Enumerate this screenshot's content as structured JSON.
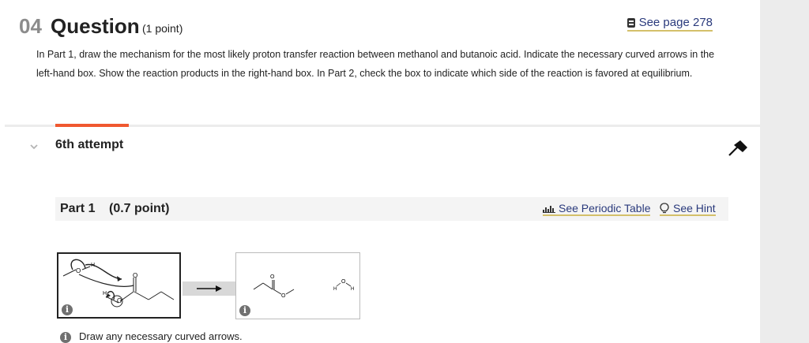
{
  "question": {
    "number": "04",
    "title": "Question",
    "points": "(1 point)",
    "see_page_label": "See page 278",
    "text": "In Part 1, draw the mechanism for the most likely proton transfer reaction between methanol and butanoic acid. Indicate the necessary curved arrows in the left-hand box. Show the reaction products in the right-hand box. In Part 2, check the box to indicate which side of the reaction is favored at equilibrium."
  },
  "attempt": {
    "label": "6th attempt"
  },
  "part1": {
    "title": "Part 1",
    "points": "(0.7 point)",
    "periodic_table_label": "See Periodic Table",
    "hint_label": "See Hint"
  },
  "reaction": {
    "left_atoms": {
      "h": "H",
      "o_methanol": "O",
      "o_carbonyl": "O",
      "o_hydroxyl": "O",
      "h_acid": "H"
    },
    "right_atoms": {
      "o_carbonyl": "O",
      "o_ester": "O",
      "o_water": "O",
      "h_left": "H",
      "h_right": "H"
    },
    "info_glyph": "i"
  },
  "note": {
    "text": "Draw any necessary curved arrows."
  },
  "icons": {
    "book": "book-icon",
    "periodic": "periodic-table-icon",
    "hint": "lightbulb-icon",
    "pin": "pin-icon",
    "chevron": "chevron-down-icon",
    "info": "info-icon"
  },
  "colors": {
    "accent": "#f0582f",
    "link": "#2a3a7c",
    "underline": "#d4c06a",
    "question_number": "#8c8c8c"
  }
}
